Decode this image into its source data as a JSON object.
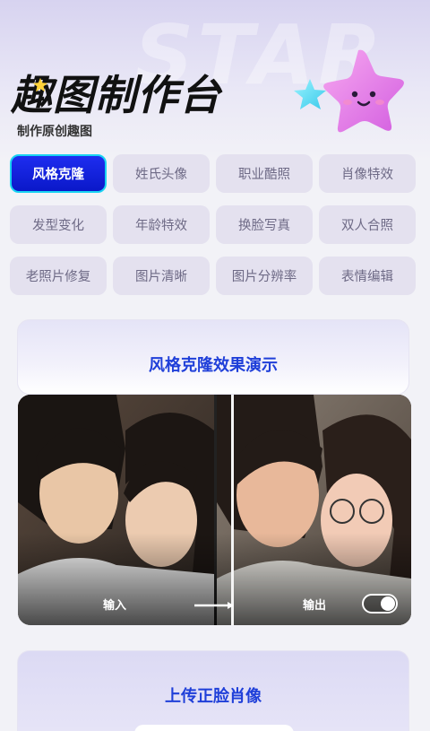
{
  "header": {
    "watermark": "STAR",
    "title": "趣图制作台",
    "subtitle": "制作原创趣图"
  },
  "categories": [
    {
      "label": "风格克隆",
      "active": true
    },
    {
      "label": "姓氏头像",
      "active": false
    },
    {
      "label": "职业酷照",
      "active": false
    },
    {
      "label": "肖像特效",
      "active": false
    },
    {
      "label": "发型变化",
      "active": false
    },
    {
      "label": "年龄特效",
      "active": false
    },
    {
      "label": "换脸写真",
      "active": false
    },
    {
      "label": "双人合照",
      "active": false
    },
    {
      "label": "老照片修复",
      "active": false
    },
    {
      "label": "图片清晰",
      "active": false
    },
    {
      "label": "图片分辨率",
      "active": false
    },
    {
      "label": "表情编辑",
      "active": false
    }
  ],
  "demo_card": {
    "title": "风格克隆效果演示",
    "input_label": "输入",
    "output_label": "输出"
  },
  "upload_card": {
    "title": "上传正脸肖像"
  },
  "colors": {
    "accent": "#1f3fd9",
    "active_chip": "#0a18c9",
    "active_border": "#19d3f2"
  }
}
